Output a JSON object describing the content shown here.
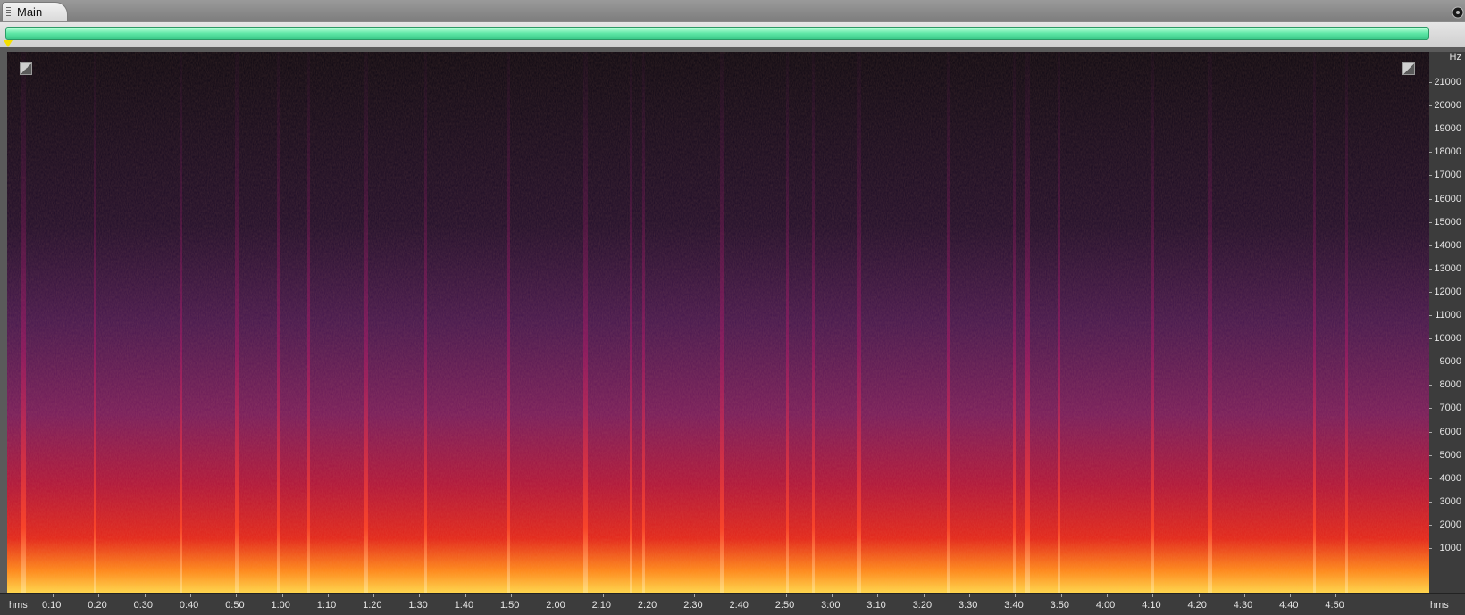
{
  "tabs": [
    {
      "label": "Main"
    }
  ],
  "freq_axis": {
    "unit": "Hz",
    "labels": [
      "21000",
      "20000",
      "19000",
      "18000",
      "17000",
      "16000",
      "15000",
      "14000",
      "13000",
      "12000",
      "11000",
      "10000",
      "9000",
      "8000",
      "7000",
      "6000",
      "5000",
      "4000",
      "3000",
      "2000",
      "1000"
    ]
  },
  "time_axis": {
    "unit_left": "hms",
    "unit_right": "hms",
    "labels": [
      "0:10",
      "0:20",
      "0:30",
      "0:40",
      "0:50",
      "1:00",
      "1:10",
      "1:20",
      "1:30",
      "1:40",
      "1:50",
      "2:00",
      "2:10",
      "2:20",
      "2:30",
      "2:40",
      "2:50",
      "3:00",
      "3:10",
      "3:20",
      "3:30",
      "3:40",
      "3:50",
      "4:00",
      "4:10",
      "4:20",
      "4:30",
      "4:40",
      "4:50"
    ]
  },
  "colors": {
    "overview_bar": "#5ee7a6",
    "playhead": "#f5e000",
    "spectrogram_low": "#ffd84a",
    "spectrogram_mid": "#c2183a",
    "spectrogram_high": "#2a0f3c"
  }
}
